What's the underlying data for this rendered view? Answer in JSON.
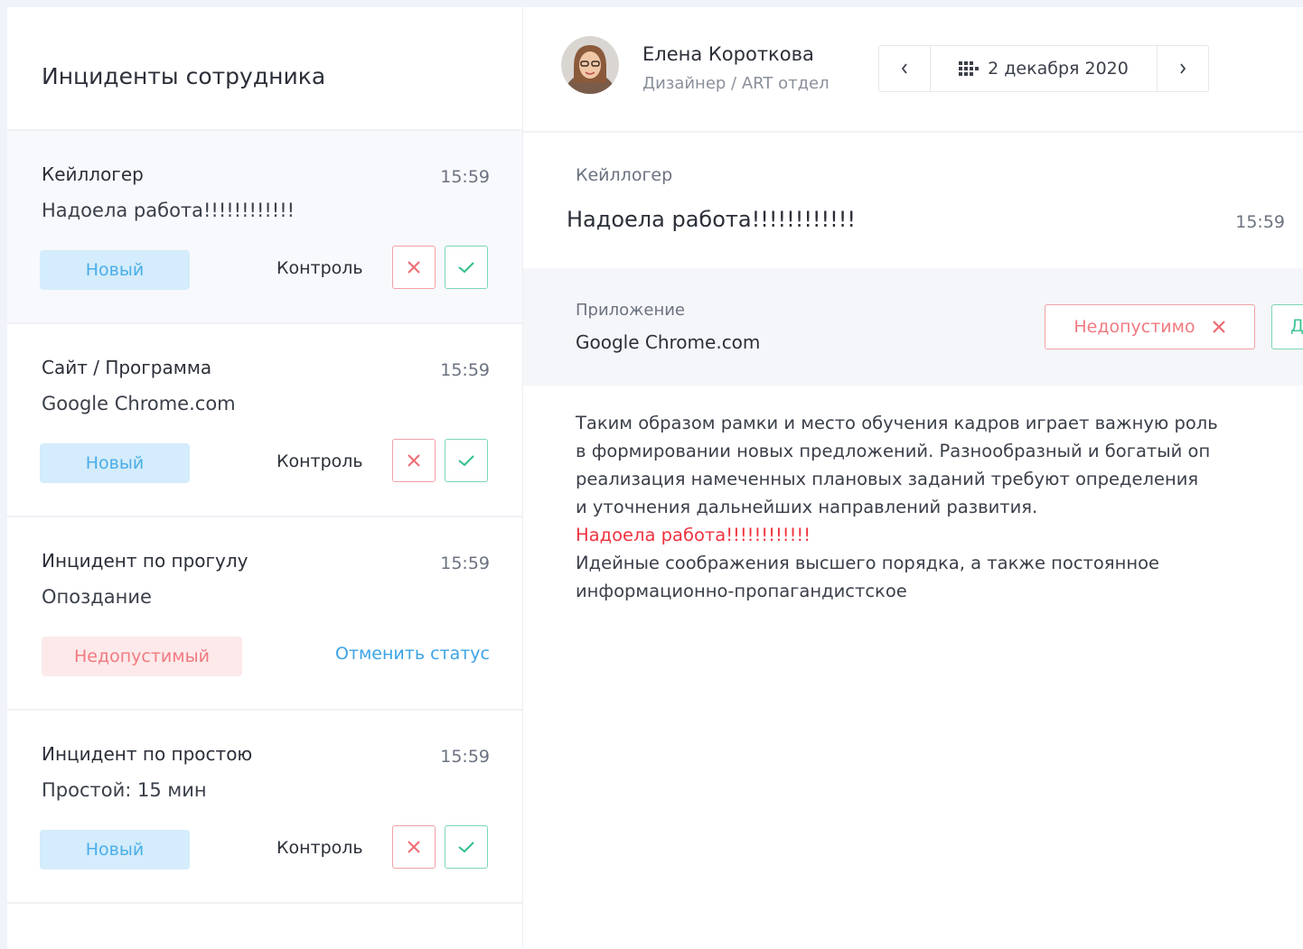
{
  "left_panel": {
    "title": "Инциденты сотрудника",
    "incidents": [
      {
        "type": "Кейллогер",
        "time": "15:59",
        "message": "Надоела работа!!!!!!!!!!!!",
        "status": "Новый",
        "control_label": "Контроль"
      },
      {
        "type": "Сайт / Программа",
        "time": "15:59",
        "message": "Google Chrome.com",
        "status": "Новый",
        "control_label": "Контроль"
      },
      {
        "type": "Инцидент по прогулу",
        "time": "15:59",
        "message": "Опоздание",
        "status": "Недопустимый",
        "cancel_label": "Отменить статус"
      },
      {
        "type": "Инцидент по простою",
        "time": "15:59",
        "message": "Простой: 15 мин",
        "status": "Новый",
        "control_label": "Контроль"
      }
    ]
  },
  "profile": {
    "name": "Елена Короткова",
    "role": "Дизайнер / ART отдел",
    "date": "2 декабря 2020"
  },
  "detail": {
    "type": "Кейллогер",
    "message": "Надоела работа!!!!!!!!!!!!",
    "time": "15:59",
    "app_label": "Приложение",
    "app_value": "Google Chrome.com",
    "reject_label": "Недопустимо",
    "accept_label_partial": "Д",
    "body_lines": [
      "Таким образом рамки и место обучения кадров играет важную роль",
      "в формировании новых предложений. Разнообразный и богатый оп",
      "реализация намеченных плановых заданий требуют определения",
      "и уточнения дальнейших направлений развития."
    ],
    "highlight_line": "Надоела работа!!!!!!!!!!!!",
    "body_lines_after": [
      "Идейные соображения высшего порядка, а также постоянное",
      "информационно-пропагандистское"
    ]
  },
  "colors": {
    "accent_blue": "#4aaee8",
    "new_badge_bg": "#d4ecfb",
    "danger": "#f07a80",
    "danger_bg": "#fde9ea",
    "success": "#43c595",
    "highlight_red": "#ee3340"
  },
  "icons": {
    "reject": "close-icon",
    "accept": "check-icon",
    "prev": "chevron-left-icon",
    "next": "chevron-right-icon",
    "calendar": "calendar-grid-icon"
  }
}
